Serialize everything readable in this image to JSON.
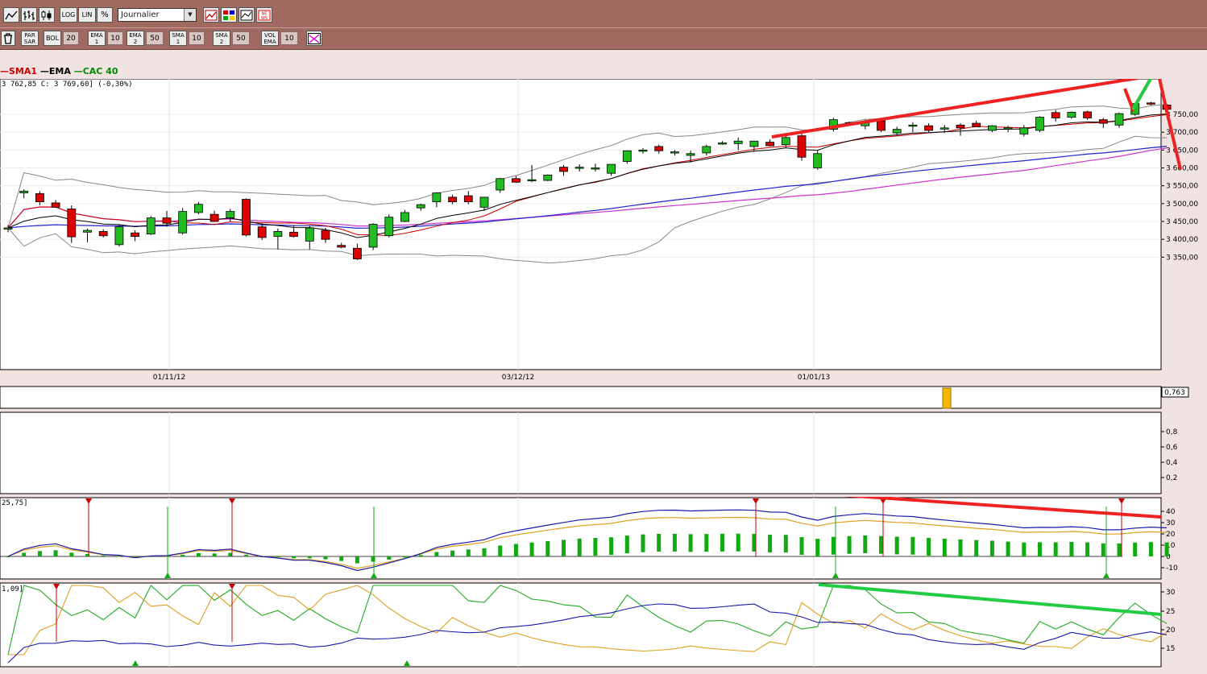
{
  "toolbar_top": {
    "log_label": "LOG",
    "lin_label": "LIN",
    "percent_label": "%",
    "period_select": "Journalier"
  },
  "toolbar_bottom": {
    "parsar_label": "PAR SAR",
    "bol_label": "BOL",
    "bol_value": "20",
    "ema1_label": "EMA 1",
    "ema1_value": "10",
    "ema2_label": "EMA 2",
    "ema2_value": "50",
    "sma1_label": "SMA 1",
    "sma1_value": "10",
    "sma2_label": "SMA 2",
    "sma2_value": "50",
    "volema_label": "VOL EMA",
    "volema_value": "10"
  },
  "legend": {
    "sma1": "SMA1",
    "ema": "EMA",
    "cac": "CAC 40"
  },
  "quote_text": "3 762,85  C: 3 769,60] (-0,30%)",
  "colors": {
    "sma1": "#cc0000",
    "ema": "#000000",
    "cac": "#008800",
    "bull": "#22bb22",
    "bear": "#dd0000",
    "trend_red": "#ee2222",
    "trend_green": "#22cc44"
  },
  "price_axis": [
    "3 750,00",
    "3 700,00",
    "3 650,00",
    "3 600,00",
    "3 550,00",
    "3 500,00",
    "3 450,00",
    "3 400,00",
    "3 350,00"
  ],
  "date_labels": [
    "01/11/12",
    "03/12/12",
    "01/01/13"
  ],
  "volume_panel": {
    "value_label": "0,763"
  },
  "panel3_axis": [
    "0,8",
    "0,6",
    "0,4",
    "0,2"
  ],
  "macd_panel": {
    "label": "25,75]",
    "axis": [
      "40",
      "30",
      "20",
      "10",
      "0",
      "-10"
    ]
  },
  "dmi_panel": {
    "label": "1,09]",
    "axis": [
      "30",
      "25",
      "20",
      "15"
    ]
  },
  "chart_data": {
    "type": "candlestick",
    "title": "",
    "ylim": [
      3320,
      3800
    ],
    "candles": [
      {
        "o": 3430,
        "h": 3440,
        "l": 3420,
        "c": 3432
      },
      {
        "o": 3530,
        "h": 3540,
        "l": 3515,
        "c": 3535
      },
      {
        "o": 3528,
        "h": 3535,
        "l": 3495,
        "c": 3505
      },
      {
        "o": 3502,
        "h": 3510,
        "l": 3488,
        "c": 3490
      },
      {
        "o": 3485,
        "h": 3495,
        "l": 3390,
        "c": 3407
      },
      {
        "o": 3420,
        "h": 3430,
        "l": 3392,
        "c": 3425
      },
      {
        "o": 3422,
        "h": 3428,
        "l": 3405,
        "c": 3410
      },
      {
        "o": 3385,
        "h": 3440,
        "l": 3380,
        "c": 3435
      },
      {
        "o": 3418,
        "h": 3425,
        "l": 3395,
        "c": 3408
      },
      {
        "o": 3415,
        "h": 3465,
        "l": 3412,
        "c": 3460
      },
      {
        "o": 3460,
        "h": 3480,
        "l": 3435,
        "c": 3445
      },
      {
        "o": 3418,
        "h": 3488,
        "l": 3413,
        "c": 3478
      },
      {
        "o": 3475,
        "h": 3505,
        "l": 3470,
        "c": 3498
      },
      {
        "o": 3470,
        "h": 3480,
        "l": 3450,
        "c": 3450
      },
      {
        "o": 3460,
        "h": 3485,
        "l": 3450,
        "c": 3478
      },
      {
        "o": 3512,
        "h": 3515,
        "l": 3408,
        "c": 3412
      },
      {
        "o": 3435,
        "h": 3445,
        "l": 3398,
        "c": 3405
      },
      {
        "o": 3408,
        "h": 3430,
        "l": 3372,
        "c": 3422
      },
      {
        "o": 3420,
        "h": 3440,
        "l": 3405,
        "c": 3408
      },
      {
        "o": 3395,
        "h": 3438,
        "l": 3372,
        "c": 3432
      },
      {
        "o": 3425,
        "h": 3432,
        "l": 3390,
        "c": 3400
      },
      {
        "o": 3383,
        "h": 3390,
        "l": 3375,
        "c": 3378
      },
      {
        "o": 3375,
        "h": 3388,
        "l": 3342,
        "c": 3345
      },
      {
        "o": 3378,
        "h": 3445,
        "l": 3370,
        "c": 3442
      },
      {
        "o": 3410,
        "h": 3470,
        "l": 3405,
        "c": 3462
      },
      {
        "o": 3450,
        "h": 3482,
        "l": 3448,
        "c": 3475
      },
      {
        "o": 3488,
        "h": 3500,
        "l": 3480,
        "c": 3497
      },
      {
        "o": 3505,
        "h": 3532,
        "l": 3490,
        "c": 3530
      },
      {
        "o": 3518,
        "h": 3525,
        "l": 3498,
        "c": 3505
      },
      {
        "o": 3522,
        "h": 3535,
        "l": 3498,
        "c": 3505
      },
      {
        "o": 3490,
        "h": 3515,
        "l": 3480,
        "c": 3518
      },
      {
        "o": 3538,
        "h": 3572,
        "l": 3530,
        "c": 3570
      },
      {
        "o": 3570,
        "h": 3578,
        "l": 3558,
        "c": 3560
      },
      {
        "o": 3565,
        "h": 3608,
        "l": 3560,
        "c": 3567
      },
      {
        "o": 3565,
        "h": 3582,
        "l": 3563,
        "c": 3580
      },
      {
        "o": 3602,
        "h": 3608,
        "l": 3578,
        "c": 3590
      },
      {
        "o": 3600,
        "h": 3610,
        "l": 3590,
        "c": 3602
      },
      {
        "o": 3598,
        "h": 3612,
        "l": 3590,
        "c": 3600
      },
      {
        "o": 3585,
        "h": 3610,
        "l": 3578,
        "c": 3610
      },
      {
        "o": 3618,
        "h": 3648,
        "l": 3612,
        "c": 3648
      },
      {
        "o": 3648,
        "h": 3655,
        "l": 3640,
        "c": 3650
      },
      {
        "o": 3660,
        "h": 3665,
        "l": 3640,
        "c": 3648
      },
      {
        "o": 3645,
        "h": 3650,
        "l": 3635,
        "c": 3645
      },
      {
        "o": 3635,
        "h": 3648,
        "l": 3615,
        "c": 3640
      },
      {
        "o": 3642,
        "h": 3665,
        "l": 3635,
        "c": 3660
      },
      {
        "o": 3670,
        "h": 3675,
        "l": 3665,
        "c": 3670
      },
      {
        "o": 3668,
        "h": 3685,
        "l": 3650,
        "c": 3675
      },
      {
        "o": 3660,
        "h": 3675,
        "l": 3645,
        "c": 3675
      },
      {
        "o": 3672,
        "h": 3680,
        "l": 3660,
        "c": 3662
      },
      {
        "o": 3665,
        "h": 3690,
        "l": 3655,
        "c": 3685
      },
      {
        "o": 3690,
        "h": 3700,
        "l": 3620,
        "c": 3630
      },
      {
        "o": 3600,
        "h": 3650,
        "l": 3595,
        "c": 3640
      },
      {
        "o": 3708,
        "h": 3740,
        "l": 3702,
        "c": 3735
      },
      {
        "o": 3727,
        "h": 3730,
        "l": 3720,
        "c": 3723
      },
      {
        "o": 3718,
        "h": 3735,
        "l": 3708,
        "c": 3730
      },
      {
        "o": 3732,
        "h": 3735,
        "l": 3700,
        "c": 3705
      },
      {
        "o": 3698,
        "h": 3715,
        "l": 3690,
        "c": 3708
      },
      {
        "o": 3720,
        "h": 3728,
        "l": 3700,
        "c": 3720
      },
      {
        "o": 3718,
        "h": 3725,
        "l": 3700,
        "c": 3705
      },
      {
        "o": 3712,
        "h": 3720,
        "l": 3698,
        "c": 3712
      },
      {
        "o": 3720,
        "h": 3725,
        "l": 3690,
        "c": 3712
      },
      {
        "o": 3725,
        "h": 3732,
        "l": 3718,
        "c": 3715
      },
      {
        "o": 3705,
        "h": 3720,
        "l": 3700,
        "c": 3718
      },
      {
        "o": 3712,
        "h": 3718,
        "l": 3700,
        "c": 3712
      },
      {
        "o": 3695,
        "h": 3720,
        "l": 3688,
        "c": 3712
      },
      {
        "o": 3705,
        "h": 3745,
        "l": 3700,
        "c": 3742
      },
      {
        "o": 3755,
        "h": 3762,
        "l": 3730,
        "c": 3740
      },
      {
        "o": 3742,
        "h": 3758,
        "l": 3738,
        "c": 3756
      },
      {
        "o": 3757,
        "h": 3760,
        "l": 3735,
        "c": 3740
      },
      {
        "o": 3735,
        "h": 3740,
        "l": 3712,
        "c": 3725
      },
      {
        "o": 3720,
        "h": 3755,
        "l": 3712,
        "c": 3752
      },
      {
        "o": 3750,
        "h": 3782,
        "l": 3746,
        "c": 3780
      },
      {
        "o": 3782,
        "h": 3785,
        "l": 3775,
        "c": 3779
      },
      {
        "o": 3776,
        "h": 3780,
        "l": 3758,
        "c": 3764
      }
    ]
  }
}
